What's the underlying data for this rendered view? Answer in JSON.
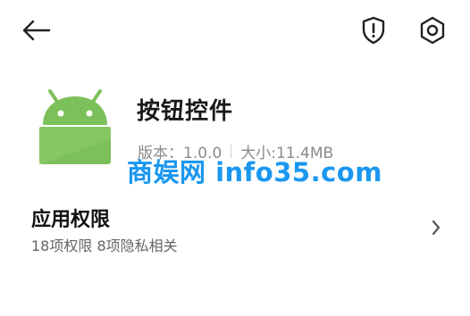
{
  "header": {
    "back_icon": "arrow-left-icon",
    "shield_icon": "shield-alert-icon",
    "settings_icon": "settings-hexagon-icon"
  },
  "app": {
    "icon": "android-robot-icon",
    "icon_color": "#7cc05a",
    "name": "按钮控件",
    "version_label": "版本：1.0.0",
    "size_label": "大小:11.4MB"
  },
  "watermark": {
    "text": "商娱网 info35.com",
    "color": "#1a97f0"
  },
  "permissions": {
    "title": "应用权限",
    "summary": "18项权限 8项隐私相关",
    "chevron_icon": "chevron-right-icon"
  }
}
